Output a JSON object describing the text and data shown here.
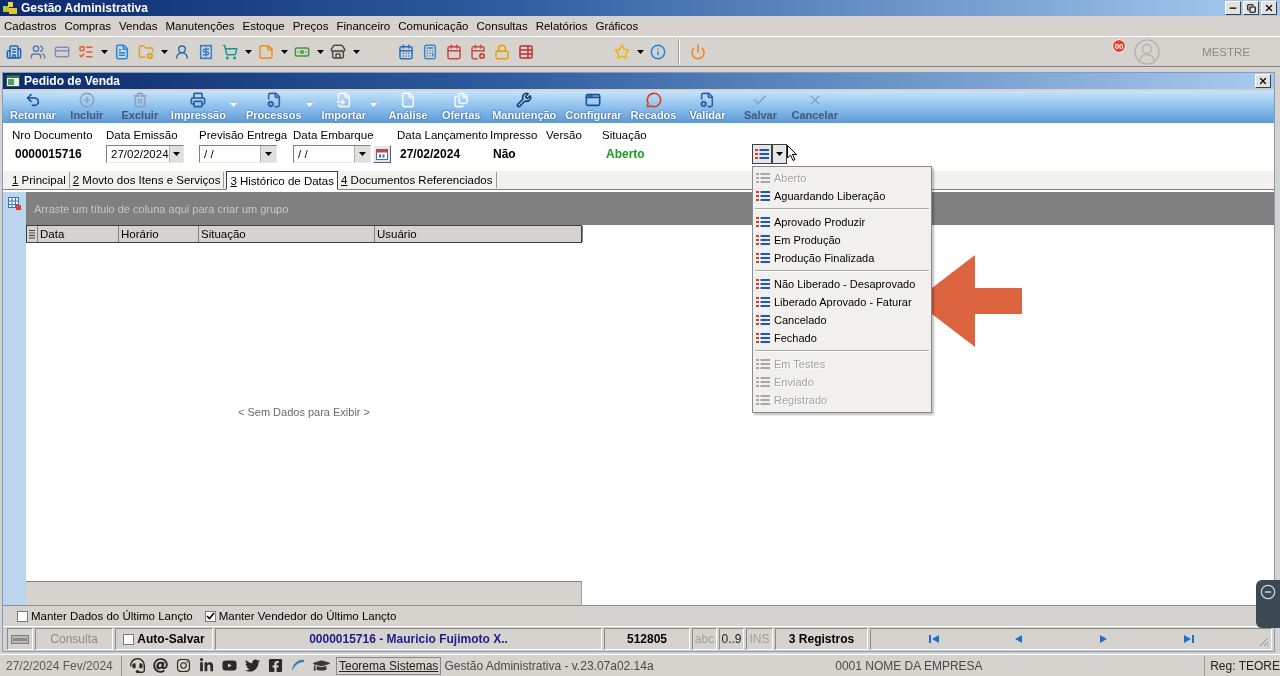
{
  "window": {
    "title": "Gestão Administrativa"
  },
  "menu_bar": [
    "Cadastros",
    "Compras",
    "Vendas",
    "Manutenções",
    "Estoque",
    "Preços",
    "Financeiro",
    "Comunicação",
    "Consultas",
    "Relatórios",
    "Gráficos"
  ],
  "toolbar": {
    "badge": "00",
    "user": "MESTRE"
  },
  "document": {
    "title": "Pedido de Venda",
    "actions": [
      {
        "label": "Retornar",
        "disabled": false,
        "menu": false
      },
      {
        "label": "Incluir",
        "disabled": true,
        "menu": false
      },
      {
        "label": "Excluir",
        "disabled": true,
        "menu": false
      },
      {
        "label": "Impressão",
        "disabled": false,
        "menu": true
      },
      {
        "label": "Processos",
        "disabled": false,
        "menu": true
      },
      {
        "label": "Importar",
        "disabled": false,
        "menu": true
      },
      {
        "label": "Análise",
        "disabled": false,
        "menu": false
      },
      {
        "label": "Ofertas",
        "disabled": false,
        "menu": false
      },
      {
        "label": "Manutenção",
        "disabled": false,
        "menu": false
      },
      {
        "label": "Configurar",
        "disabled": false,
        "menu": false
      },
      {
        "label": "Recados",
        "disabled": false,
        "menu": false
      },
      {
        "label": "Validar",
        "disabled": false,
        "menu": false
      },
      {
        "label": "Salvar",
        "disabled": true,
        "menu": false
      },
      {
        "label": "Cancelar",
        "disabled": true,
        "menu": false
      }
    ],
    "fields": [
      {
        "kind": "text",
        "label": "Nro Documento",
        "value": "0000015716"
      },
      {
        "kind": "combo",
        "label": "Data Emissão",
        "value": "27/02/2024"
      },
      {
        "kind": "combo",
        "label": "Previsão Entrega",
        "value": "/ /"
      },
      {
        "kind": "combo_calendar",
        "label": "Data Embarque",
        "value": "/ /"
      },
      {
        "kind": "text",
        "label": "Data Lançamento",
        "value": "27/02/2024"
      },
      {
        "kind": "text",
        "label": "Impresso",
        "value": "Não"
      },
      {
        "kind": "text",
        "label": "Versão"
      },
      {
        "kind": "status",
        "label": "Situação",
        "value": "Aberto"
      }
    ],
    "status_menu": {
      "groups": [
        {
          "items": [
            {
              "label": "Aberto",
              "disabled": true
            },
            {
              "label": "Aguardando Liberação",
              "disabled": false
            }
          ]
        },
        {
          "items": [
            {
              "label": "Aprovado Produzir",
              "disabled": false
            },
            {
              "label": "Em Produção",
              "disabled": false
            },
            {
              "label": "Produção Finalizada",
              "disabled": false
            }
          ]
        },
        {
          "items": [
            {
              "label": "Não Liberado - Desaprovado",
              "disabled": false
            },
            {
              "label": "Liberado Aprovado - Faturar",
              "disabled": false
            },
            {
              "label": "Cancelado",
              "disabled": false
            },
            {
              "label": "Fechado",
              "disabled": false
            }
          ]
        },
        {
          "items": [
            {
              "label": "Em Testes",
              "disabled": true
            },
            {
              "label": "Enviado",
              "disabled": true
            },
            {
              "label": "Registrado",
              "disabled": true
            }
          ]
        }
      ]
    },
    "tabs": [
      {
        "key": "1",
        "label": "Principal",
        "selected": false
      },
      {
        "key": "2",
        "label": "Movto dos Itens e Serviços",
        "selected": false
      },
      {
        "key": "3",
        "label": "Histórico de Datas",
        "selected": true
      },
      {
        "key": "4",
        "label": "Documentos Referenciados",
        "selected": false
      }
    ],
    "grid": {
      "group_hint": "Arraste um título de coluna aqui para criar um grupo",
      "columns": [
        "Data",
        "Horário",
        "Situação",
        "Usuário"
      ],
      "empty_text": "< Sem Dados para Exibir >"
    },
    "options": [
      {
        "label": "Manter Dados do Último Lançto",
        "checked": false
      },
      {
        "label": "Manter Vendedor do Último Lançto",
        "checked": true
      }
    ],
    "status_bar": {
      "mode": {
        "label": "Consulta",
        "disabled": true
      },
      "auto_save": {
        "label": "Auto-Salvar",
        "checked": false
      },
      "record": "0000015716 - Mauricio Fujimoto X..",
      "code": "512805",
      "indicators": [
        {
          "label": "abc",
          "on": false
        },
        {
          "label": "0..9",
          "on": true
        },
        {
          "label": "INS",
          "on": false
        }
      ],
      "count": "3 Registros"
    }
  },
  "footer": {
    "date": "27/2/2024 Fev/2024",
    "link": "Teorema Sistemas",
    "version": "Gestão Administrativa - v.23.07a02.14a",
    "company": "0001 NOME DA EMPRESA",
    "registration": "Reg: TEORE"
  }
}
